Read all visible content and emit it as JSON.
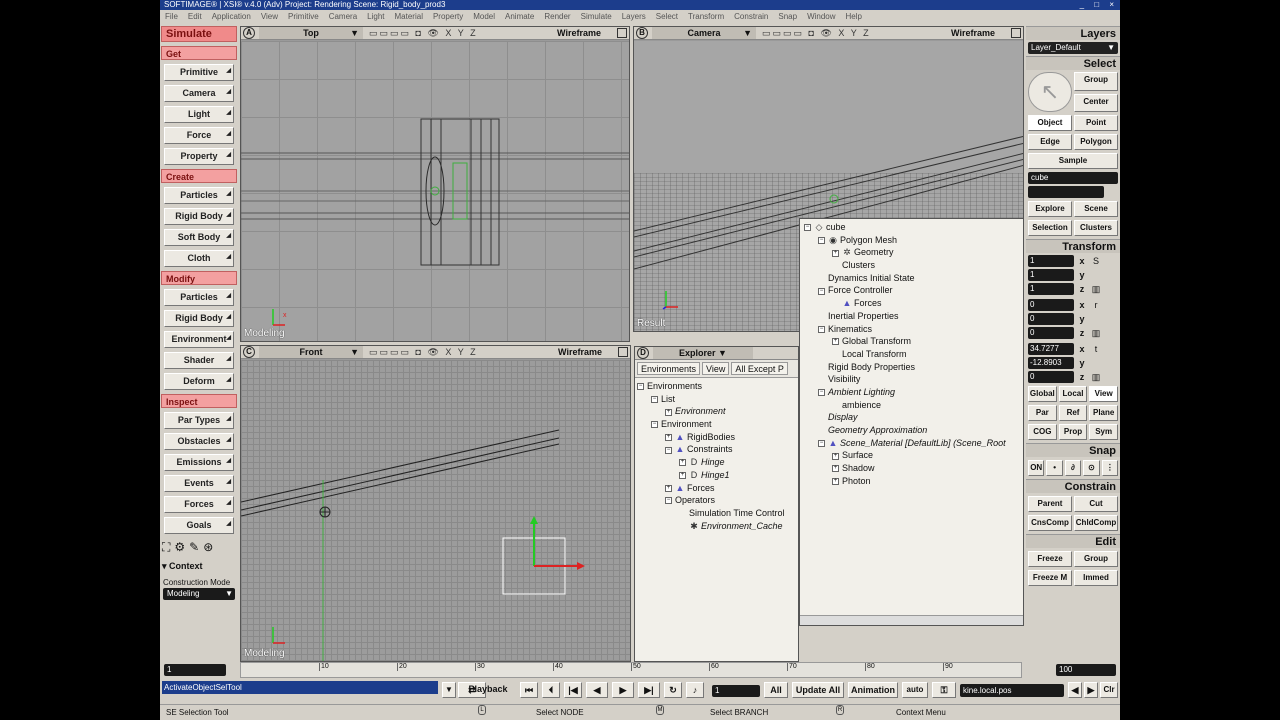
{
  "window": {
    "title": "SOFTIMAGE® | XSI® v.4.0 (Adv) Project: Rendering    Scene: Rigid_body_prod3",
    "controls": "_ □ ×"
  },
  "menubar": [
    "File",
    "Edit",
    "Application",
    "View",
    "Primitive",
    "Camera",
    "Light",
    "Material",
    "Property",
    "Model",
    "Animate",
    "Render",
    "Simulate",
    "Layers",
    "Select",
    "Transform",
    "Constrain",
    "Snap",
    "Window",
    "Help"
  ],
  "left_panel": {
    "title": "Simulate",
    "get": {
      "label": "Get",
      "items": [
        "Primitive",
        "Camera",
        "Light",
        "Force",
        "Property"
      ]
    },
    "create": {
      "label": "Create",
      "items": [
        "Particles",
        "Rigid Body",
        "Soft Body",
        "Cloth"
      ]
    },
    "modify": {
      "label": "Modify",
      "items": [
        "Particles",
        "Rigid Body",
        "Environment",
        "Shader",
        "Deform"
      ]
    },
    "inspect": {
      "label": "Inspect",
      "items": [
        "Par Types",
        "Obstacles",
        "Emissions",
        "Events",
        "Forces",
        "Goals"
      ]
    },
    "context_label": "▾ Context",
    "construction_label": "Construction Mode",
    "construction_value": "Modeling"
  },
  "viewports": {
    "a": {
      "letter": "A",
      "name": "Top",
      "xyz": "X Y Z",
      "mode": "Wireframe",
      "label": "Modeling"
    },
    "b": {
      "letter": "B",
      "name": "Camera",
      "xyz": "X Y Z",
      "mode": "Wireframe",
      "label": "Result"
    },
    "c": {
      "letter": "C",
      "name": "Front",
      "xyz": "X Y Z",
      "mode": "Wireframe",
      "label": "Modeling"
    },
    "d": {
      "letter": "D",
      "name": "Explorer"
    }
  },
  "explorer": {
    "tabs": [
      "Environments",
      "View",
      "All Except P"
    ],
    "tree": [
      {
        "indent": 0,
        "pm": "−",
        "icon": "",
        "label": "Environments",
        "italic": false
      },
      {
        "indent": 1,
        "pm": "−",
        "icon": "",
        "label": "List",
        "italic": false
      },
      {
        "indent": 2,
        "pm": "+",
        "icon": "",
        "label": "Environment",
        "italic": true
      },
      {
        "indent": 1,
        "pm": "−",
        "icon": "",
        "label": "Environment",
        "italic": false
      },
      {
        "indent": 2,
        "pm": "+",
        "icon": "▲",
        "label": "RigidBodies",
        "italic": false
      },
      {
        "indent": 2,
        "pm": "−",
        "icon": "▲",
        "label": "Constraints",
        "italic": false
      },
      {
        "indent": 3,
        "pm": "+",
        "icon": "D",
        "label": "Hinge",
        "italic": true
      },
      {
        "indent": 3,
        "pm": "+",
        "icon": "D",
        "label": "Hinge1",
        "italic": true
      },
      {
        "indent": 2,
        "pm": "+",
        "icon": "▲",
        "label": "Forces",
        "italic": false
      },
      {
        "indent": 2,
        "pm": "−",
        "icon": "",
        "label": "Operators",
        "italic": false
      },
      {
        "indent": 3,
        "pm": "",
        "icon": "",
        "label": "Simulation Time Control",
        "italic": false
      },
      {
        "indent": 3,
        "pm": "",
        "icon": "✱",
        "label": "Environment_Cache",
        "italic": true
      }
    ]
  },
  "property_tree": [
    {
      "indent": 0,
      "pm": "−",
      "icon": "◇",
      "label": "cube",
      "italic": false
    },
    {
      "indent": 1,
      "pm": "−",
      "icon": "◉",
      "label": "Polygon Mesh",
      "italic": false
    },
    {
      "indent": 2,
      "pm": "+",
      "icon": "✲",
      "label": "Geometry",
      "italic": false
    },
    {
      "indent": 2,
      "pm": "",
      "icon": "",
      "label": "Clusters",
      "italic": false
    },
    {
      "indent": 1,
      "pm": "",
      "icon": "",
      "label": "Dynamics Initial State",
      "italic": false
    },
    {
      "indent": 1,
      "pm": "−",
      "icon": "",
      "label": "Force Controller",
      "italic": false
    },
    {
      "indent": 2,
      "pm": "",
      "icon": "▲",
      "label": "Forces",
      "italic": false
    },
    {
      "indent": 1,
      "pm": "",
      "icon": "",
      "label": "Inertial Properties",
      "italic": false
    },
    {
      "indent": 1,
      "pm": "−",
      "icon": "",
      "label": "Kinematics",
      "italic": false
    },
    {
      "indent": 2,
      "pm": "+",
      "icon": "",
      "label": "Global Transform",
      "italic": false
    },
    {
      "indent": 2,
      "pm": "",
      "icon": "",
      "label": "Local Transform",
      "italic": false
    },
    {
      "indent": 1,
      "pm": "",
      "icon": "",
      "label": "Rigid Body Properties",
      "italic": false
    },
    {
      "indent": 1,
      "pm": "",
      "icon": "",
      "label": "Visibility",
      "italic": false
    },
    {
      "indent": 1,
      "pm": "−",
      "icon": "",
      "label": "Ambient Lighting",
      "italic": true
    },
    {
      "indent": 2,
      "pm": "",
      "icon": "",
      "label": "ambience",
      "italic": false
    },
    {
      "indent": 1,
      "pm": "",
      "icon": "",
      "label": "Display",
      "italic": true
    },
    {
      "indent": 1,
      "pm": "",
      "icon": "",
      "label": "Geometry Approximation",
      "italic": true
    },
    {
      "indent": 1,
      "pm": "−",
      "icon": "▲",
      "label": "Scene_Material [DefaultLib] (Scene_Root",
      "italic": true
    },
    {
      "indent": 2,
      "pm": "+",
      "icon": "",
      "label": "Surface",
      "italic": false
    },
    {
      "indent": 2,
      "pm": "+",
      "icon": "",
      "label": "Shadow",
      "italic": false
    },
    {
      "indent": 2,
      "pm": "+",
      "icon": "",
      "label": "Photon",
      "italic": false
    }
  ],
  "right_panel": {
    "layers_label": "Layers",
    "layer_value": "Layer_Default",
    "select_label": "Select",
    "select_buttons": [
      "Group",
      "Center",
      "Object",
      "Point",
      "Edge",
      "Polygon",
      "Sample"
    ],
    "selection_field": "cube",
    "explore_row": [
      "Explore",
      "Scene",
      "Selection",
      "Clusters"
    ],
    "transform_label": "Transform",
    "scale": [
      {
        "val": "1",
        "ax": "x"
      },
      {
        "val": "1",
        "ax": "y"
      },
      {
        "val": "1",
        "ax": "z"
      }
    ],
    "scale_btn": "S",
    "rotate": [
      {
        "val": "0",
        "ax": "x"
      },
      {
        "val": "0",
        "ax": "y"
      },
      {
        "val": "0",
        "ax": "z"
      }
    ],
    "rotate_btn": "r",
    "translate": [
      {
        "val": "34.7277",
        "ax": "x"
      },
      {
        "val": "-12.8903",
        "ax": "y"
      },
      {
        "val": "0",
        "ax": "z"
      }
    ],
    "translate_btn": "t",
    "ref_row1": [
      "Global",
      "Local",
      "View"
    ],
    "ref_row2": [
      "Par",
      "Ref",
      "Plane"
    ],
    "ref_row3": [
      "COG",
      "Prop",
      "Sym"
    ],
    "snap_label": "Snap",
    "snap_row": [
      "ON",
      "•",
      "∂",
      "⊙",
      "⋮"
    ],
    "constrain_label": "Constrain",
    "constrain_row1": [
      "Parent",
      "Cut"
    ],
    "constrain_row2": [
      "CnsComp",
      "ChldComp"
    ],
    "edit_label": "Edit",
    "edit_row1": [
      "Freeze",
      "Group"
    ],
    "edit_row2": [
      "Freeze M",
      "Immed"
    ]
  },
  "timeline": {
    "start": "1",
    "end": "100",
    "ticks": [
      "10",
      "20",
      "30",
      "40",
      "50",
      "60",
      "70",
      "80",
      "90"
    ]
  },
  "bottom": {
    "command": "ActivateObjectSelTool",
    "playback": "Playback",
    "frame": "1",
    "all": "All",
    "update_all": "Update All",
    "animation": "Animation",
    "auto": "auto",
    "kine_field": "kine.local.pos",
    "clr": "Clr"
  },
  "status": {
    "tool": "SE Selection Tool",
    "left": "Select NODE",
    "middle": "Select BRANCH",
    "right": "Context Menu"
  }
}
